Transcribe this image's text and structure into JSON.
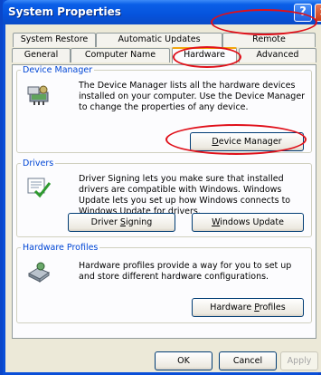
{
  "window": {
    "title": "System Properties",
    "help_glyph": "?",
    "close_glyph": "×"
  },
  "tabs_row1": [
    {
      "label": "System Restore"
    },
    {
      "label": "Automatic Updates"
    },
    {
      "label": "Remote"
    }
  ],
  "tabs_row2": [
    {
      "label": "General"
    },
    {
      "label": "Computer Name"
    },
    {
      "label": "Hardware",
      "selected": true
    },
    {
      "label": "Advanced"
    }
  ],
  "device_manager": {
    "legend": "Device Manager",
    "text": "The Device Manager lists all the hardware devices installed on your computer. Use the Device Manager to change the properties of any device.",
    "button_pre": "",
    "button_u": "D",
    "button_post": "evice Manager"
  },
  "drivers": {
    "legend": "Drivers",
    "text": "Driver Signing lets you make sure that installed drivers are compatible with Windows. Windows Update lets you set up how Windows connects to Windows Update for drivers.",
    "signing_pre": "Driver ",
    "signing_u": "S",
    "signing_post": "igning",
    "update_pre": "",
    "update_u": "W",
    "update_post": "indows Update"
  },
  "hardware_profiles": {
    "legend": "Hardware Profiles",
    "text": "Hardware profiles provide a way for you to set up and store different hardware configurations.",
    "button_pre": "Hardware ",
    "button_u": "P",
    "button_post": "rofiles"
  },
  "footer": {
    "ok": "OK",
    "cancel": "Cancel",
    "apply": "Apply"
  },
  "colors": {
    "annotation": "#e0101a",
    "legend": "#0046d5",
    "selected_tab_accent": "#f2a60e"
  }
}
